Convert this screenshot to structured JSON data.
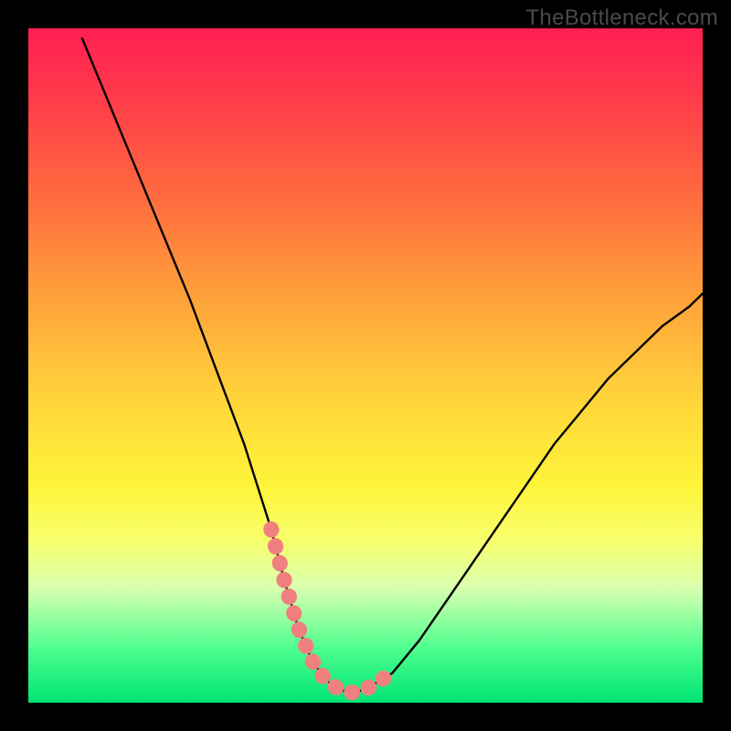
{
  "watermark": "TheBottleneck.com",
  "chart_data": {
    "type": "line",
    "title": "",
    "xlabel": "",
    "ylabel": "",
    "xlim": [
      0,
      100
    ],
    "ylim": [
      0,
      100
    ],
    "grid": false,
    "series": [
      {
        "name": "bottleneck-curve",
        "x": [
          8,
          12,
          16,
          20,
          24,
          28,
          32,
          36,
          38,
          40,
          42,
          44,
          46,
          48,
          50,
          54,
          58,
          62,
          66,
          70,
          74,
          78,
          82,
          86,
          90,
          94,
          98,
          100
        ],
        "values": [
          100,
          90,
          80,
          70,
          60,
          49,
          38,
          25,
          17,
          10,
          5,
          2,
          0.5,
          0,
          0.5,
          3,
          8,
          14,
          20,
          26,
          32,
          38,
          43,
          48,
          52,
          56,
          59,
          61
        ]
      }
    ],
    "optimal_range": {
      "x": [
        36,
        38,
        40,
        42,
        44,
        46,
        48,
        50,
        54
      ],
      "values": [
        25,
        17,
        10,
        5,
        2,
        0.5,
        0,
        0.5,
        3
      ]
    },
    "gradient_stops": [
      {
        "pos": 0,
        "color": "#ff1f52",
        "meaning": "severe-bottleneck"
      },
      {
        "pos": 25,
        "color": "#ff6b3f"
      },
      {
        "pos": 55,
        "color": "#ffd43a"
      },
      {
        "pos": 76,
        "color": "#f7ff6d"
      },
      {
        "pos": 100,
        "color": "#00e472",
        "meaning": "no-bottleneck"
      }
    ]
  }
}
